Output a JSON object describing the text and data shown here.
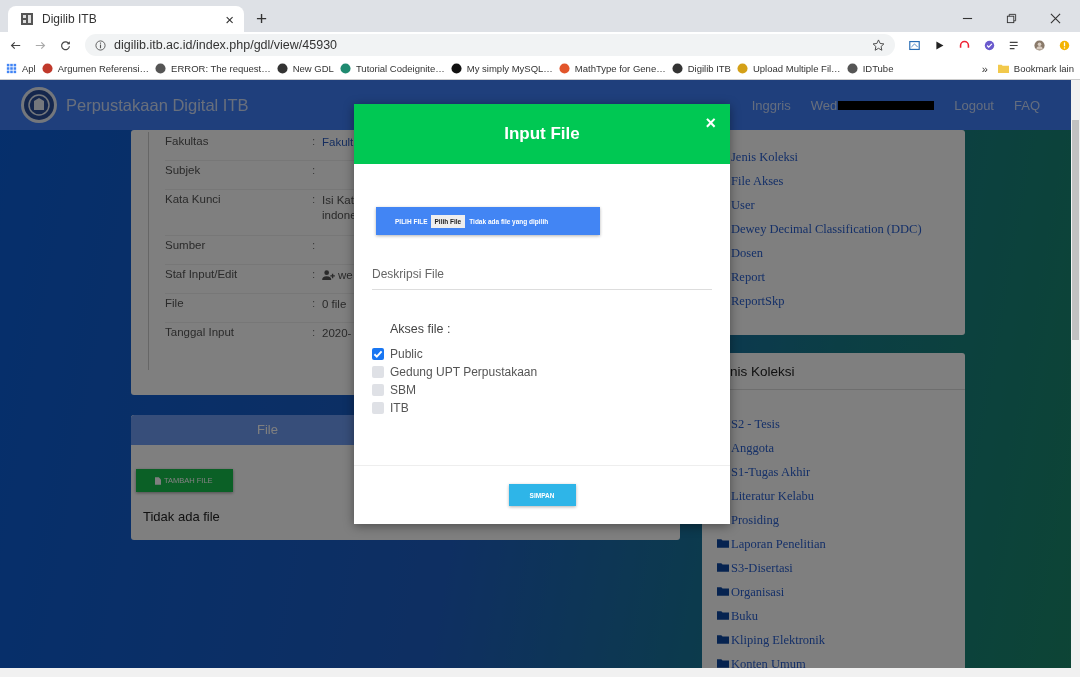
{
  "browser": {
    "tab": {
      "title": "Digilib ITB",
      "close": "×"
    },
    "new_tab": "+",
    "url": "digilib.itb.ac.id/index.php/gdl/view/45930",
    "bookmarks": [
      {
        "label": "Apl",
        "kind": "apps",
        "color": "#4285f4"
      },
      {
        "label": "Argumen Referensi…",
        "kind": "site",
        "color": "#c0392b"
      },
      {
        "label": "ERROR: The request…",
        "kind": "site",
        "color": "#555555"
      },
      {
        "label": "New GDL",
        "kind": "site",
        "color": "#333333"
      },
      {
        "label": "Tutorial Codeignite…",
        "kind": "site",
        "color": "#1f8a70"
      },
      {
        "label": "My simply MySQL…",
        "kind": "site",
        "color": "#111111"
      },
      {
        "label": "MathType for Gene…",
        "kind": "site",
        "color": "#e2552b"
      },
      {
        "label": "Digilib ITB",
        "kind": "site",
        "color": "#333333"
      },
      {
        "label": "Upload Multiple Fil…",
        "kind": "site",
        "color": "#d4a017"
      },
      {
        "label": "IDTube",
        "kind": "site",
        "color": "#555555"
      }
    ],
    "overflow": "»",
    "other_bookmarks": "Bookmark lain"
  },
  "navbar": {
    "brand": "Perpustakaan Digital ITB",
    "links": [
      {
        "label": "Inggris",
        "kind": "link"
      },
      {
        "label": "Wed",
        "kind": "user"
      },
      {
        "label": "Logout",
        "kind": "link"
      },
      {
        "label": "FAQ",
        "kind": "link"
      }
    ]
  },
  "detail": {
    "rows": [
      {
        "label": "Fakultas",
        "separator": ":",
        "value": "Fakult",
        "kind": "text"
      },
      {
        "label": "Subjek",
        "separator": ":",
        "value": "",
        "kind": "text"
      },
      {
        "label": "Kata Kunci",
        "separator": ":",
        "value": "Isi Kat\nindone",
        "kind": "text"
      },
      {
        "label": "Sumber",
        "separator": ":",
        "value": "",
        "kind": "text"
      },
      {
        "label": "Staf Input/Edit",
        "separator": ":",
        "value": "we",
        "kind": "user"
      },
      {
        "label": "File",
        "separator": ":",
        "value": "0 file",
        "kind": "text"
      },
      {
        "label": "Tanggal Input",
        "separator": ":",
        "value": "2020-",
        "kind": "text"
      }
    ]
  },
  "file_panel": {
    "title": "File",
    "add_button": "TAMBAH FILE",
    "empty_text": "Tidak ada file"
  },
  "menu_panel": {
    "items": [
      {
        "label": "Jenis Koleksi",
        "kind": "link"
      },
      {
        "label": "File Akses",
        "kind": "link"
      },
      {
        "label": "User",
        "kind": "link"
      },
      {
        "label": "Dewey Decimal Classification (DDC)",
        "kind": "link"
      },
      {
        "label": "Dosen",
        "kind": "link"
      },
      {
        "label": "Report",
        "kind": "link"
      },
      {
        "label": "ReportSkp",
        "kind": "link"
      }
    ]
  },
  "collection_panel": {
    "title": "nis Koleksi",
    "items": [
      {
        "label": "S2 - Tesis",
        "kind": "link"
      },
      {
        "label": "Anggota",
        "kind": "link"
      },
      {
        "label": "S1-Tugas Akhir",
        "kind": "link"
      },
      {
        "label": "Literatur Kelabu",
        "kind": "link"
      },
      {
        "label": "Prosiding",
        "kind": "link"
      },
      {
        "label": "Laporan Penelitian",
        "kind": "folder"
      },
      {
        "label": "S3-Disertasi",
        "kind": "folder"
      },
      {
        "label": "Organisasi",
        "kind": "folder"
      },
      {
        "label": "Buku",
        "kind": "folder"
      },
      {
        "label": "Kliping Elektronik",
        "kind": "folder"
      },
      {
        "label": "Konten Umum",
        "kind": "folder"
      }
    ]
  },
  "modal": {
    "title": "Input File",
    "close": "×",
    "file_picker": {
      "label": "PILIH FILE",
      "button": "Pilih File",
      "status": "Tidak ada file yang dipilih"
    },
    "description": {
      "placeholder": "Deskripsi File"
    },
    "access_label": "Akses file :",
    "access_options": [
      {
        "label": "Public",
        "checked": true
      },
      {
        "label": "Gedung UPT Perpustakaan",
        "checked": false
      },
      {
        "label": "SBM",
        "checked": false
      },
      {
        "label": "ITB",
        "checked": false
      }
    ],
    "submit": "SIMPAN"
  }
}
